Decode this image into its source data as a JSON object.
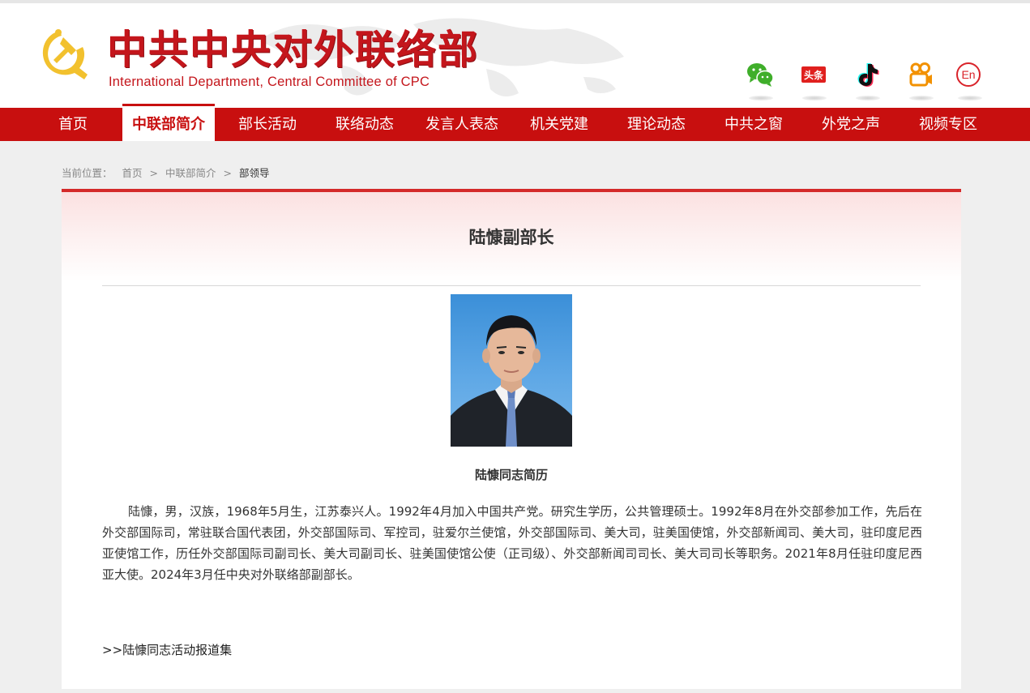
{
  "header": {
    "title_cn": "中共中央对外联络部",
    "title_en": "International Department, Central Committee of CPC",
    "social": [
      {
        "name": "wechat-icon"
      },
      {
        "name": "toutiao-icon",
        "label": "头条"
      },
      {
        "name": "tiktok-icon"
      },
      {
        "name": "kuaishou-icon"
      },
      {
        "name": "english-icon",
        "label": "En"
      }
    ]
  },
  "nav": {
    "items": [
      "首页",
      "中联部简介",
      "部长活动",
      "联络动态",
      "发言人表态",
      "机关党建",
      "理论动态",
      "中共之窗",
      "外党之声",
      "视频专区"
    ],
    "active_index": 1
  },
  "breadcrumb": {
    "prefix": "当前位置：",
    "items": [
      "首页",
      "中联部简介",
      "部领导"
    ],
    "separator": ">"
  },
  "article": {
    "title": "陆慷副部长",
    "subheading": "陆慷同志简历",
    "bio": "陆慷，男，汉族，1968年5月生，江苏泰兴人。1992年4月加入中国共产党。研究生学历，公共管理硕士。1992年8月在外交部参加工作，先后在外交部国际司，常驻联合国代表团，外交部国际司、军控司，驻爱尔兰使馆，外交部国际司、美大司，驻美国使馆，外交部新闻司、美大司，驻印度尼西亚使馆工作，历任外交部国际司副司长、美大司副司长、驻美国使馆公使（正司级）、外交部新闻司司长、美大司司长等职务。2021年8月任驻印度尼西亚大使。2024年3月任中央对外联络部副部长。",
    "report_link": ">>陆慷同志活动报道集"
  },
  "colors": {
    "brand_red": "#c80f0f",
    "title_red": "#c4161c",
    "panel_border": "#d42a2a"
  }
}
